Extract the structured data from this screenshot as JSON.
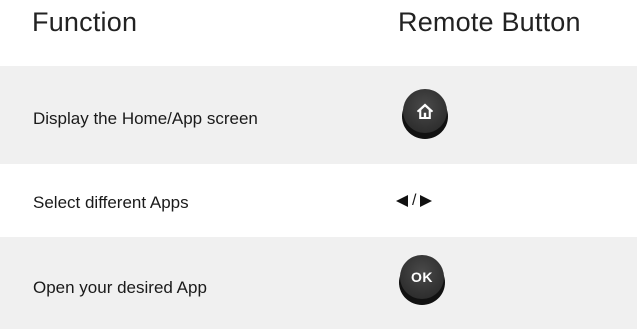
{
  "header": {
    "function_label": "Function",
    "button_label": "Remote Button"
  },
  "rows": [
    {
      "function": "Display the Home/App screen",
      "button_icon": "home-icon"
    },
    {
      "function": "Select different Apps",
      "button_icon": "left-right-arrows-icon",
      "separator": "/"
    },
    {
      "function": "Open your desired App",
      "button_icon": "ok-button",
      "button_text": "OK"
    }
  ],
  "colors": {
    "row_shade": "#f0f0f0",
    "button_dark": "#333333",
    "text": "#1a1a1a"
  }
}
